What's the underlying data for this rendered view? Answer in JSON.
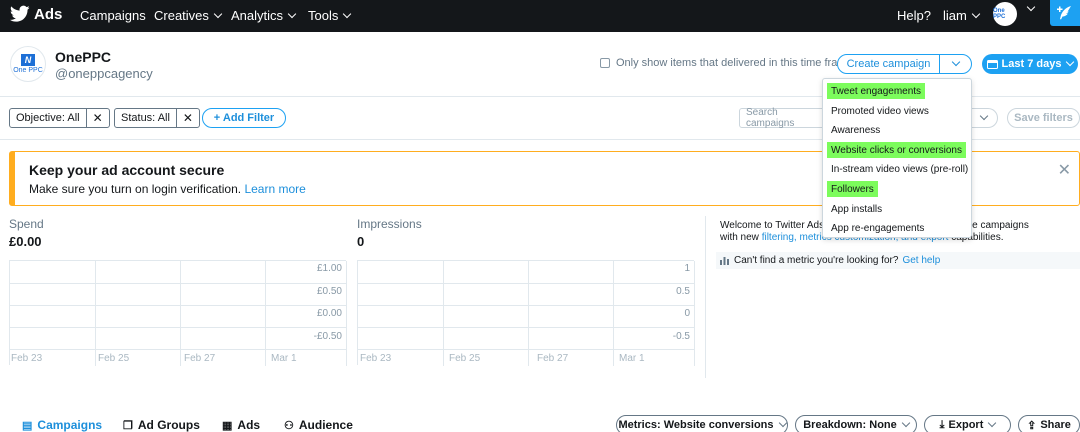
{
  "nav": {
    "brand": "Ads",
    "items": [
      "Campaigns",
      "Creatives",
      "Analytics",
      "Tools"
    ],
    "help": "Help?",
    "user": "liam"
  },
  "account": {
    "logo_text": "One PPC",
    "logo_letter": "N",
    "name": "OnePPC",
    "handle": "@oneppcagency"
  },
  "header": {
    "only_show_label": "Only show items that delivered in this time frame",
    "create_campaign": "Create campaign",
    "date_range": "Last 7 days"
  },
  "filters": {
    "objective": "Objective: All",
    "status": "Status: All",
    "add_filter": "+ Add Filter",
    "search_placeholder": "Search campaigns",
    "save_filters": "Save filters"
  },
  "alert": {
    "title": "Keep your ad account secure",
    "text": "Make sure you turn on login verification.",
    "link": "Learn more"
  },
  "metrics": {
    "spend": {
      "label": "Spend",
      "value": "£0.00",
      "y_ticks": [
        "£1.00",
        "£0.50",
        "£0.00",
        "-£0.50"
      ],
      "x_ticks": [
        "Feb 23",
        "Feb 25",
        "Feb 27",
        "Mar 1"
      ]
    },
    "impressions": {
      "label": "Impressions",
      "value": "0",
      "y_ticks": [
        "1",
        "0.5",
        "0",
        "-0.5"
      ],
      "x_ticks": [
        "Feb 23",
        "Feb 25",
        "Feb 27",
        "Mar 1"
      ]
    }
  },
  "welcome": {
    "prefix": "Welcome to Twitter Ads",
    "suffix": "d optimize campaigns",
    "line2_prefix": "with new",
    "link1": "filtering,",
    "link2": "metrics customization, and export",
    "line2_suffix": "capabilities.",
    "help_text": "Can't find a metric you're looking for?",
    "help_link": "Get help"
  },
  "dropdown": {
    "items": [
      {
        "label": "Tweet engagements",
        "highlighted": true
      },
      {
        "label": "Promoted video views",
        "highlighted": false
      },
      {
        "label": "Awareness",
        "highlighted": false
      },
      {
        "label": "Website clicks or conversions",
        "highlighted": true
      },
      {
        "label": "In-stream video views (pre-roll)",
        "highlighted": false
      },
      {
        "label": "Followers",
        "highlighted": true
      },
      {
        "label": "App installs",
        "highlighted": false
      },
      {
        "label": "App re-engagements",
        "highlighted": false
      }
    ]
  },
  "tabs": [
    "Campaigns",
    "Ad Groups",
    "Ads",
    "Audience"
  ],
  "bottom_controls": {
    "metrics": "Metrics: Website conversions",
    "breakdown": "Breakdown: None",
    "export": "Export",
    "share": "Share"
  },
  "colors": {
    "nav_bg": "#14171a",
    "accent": "#1da1f2",
    "alert_border": "#ffad1f",
    "highlight": "#7cfc5c"
  }
}
